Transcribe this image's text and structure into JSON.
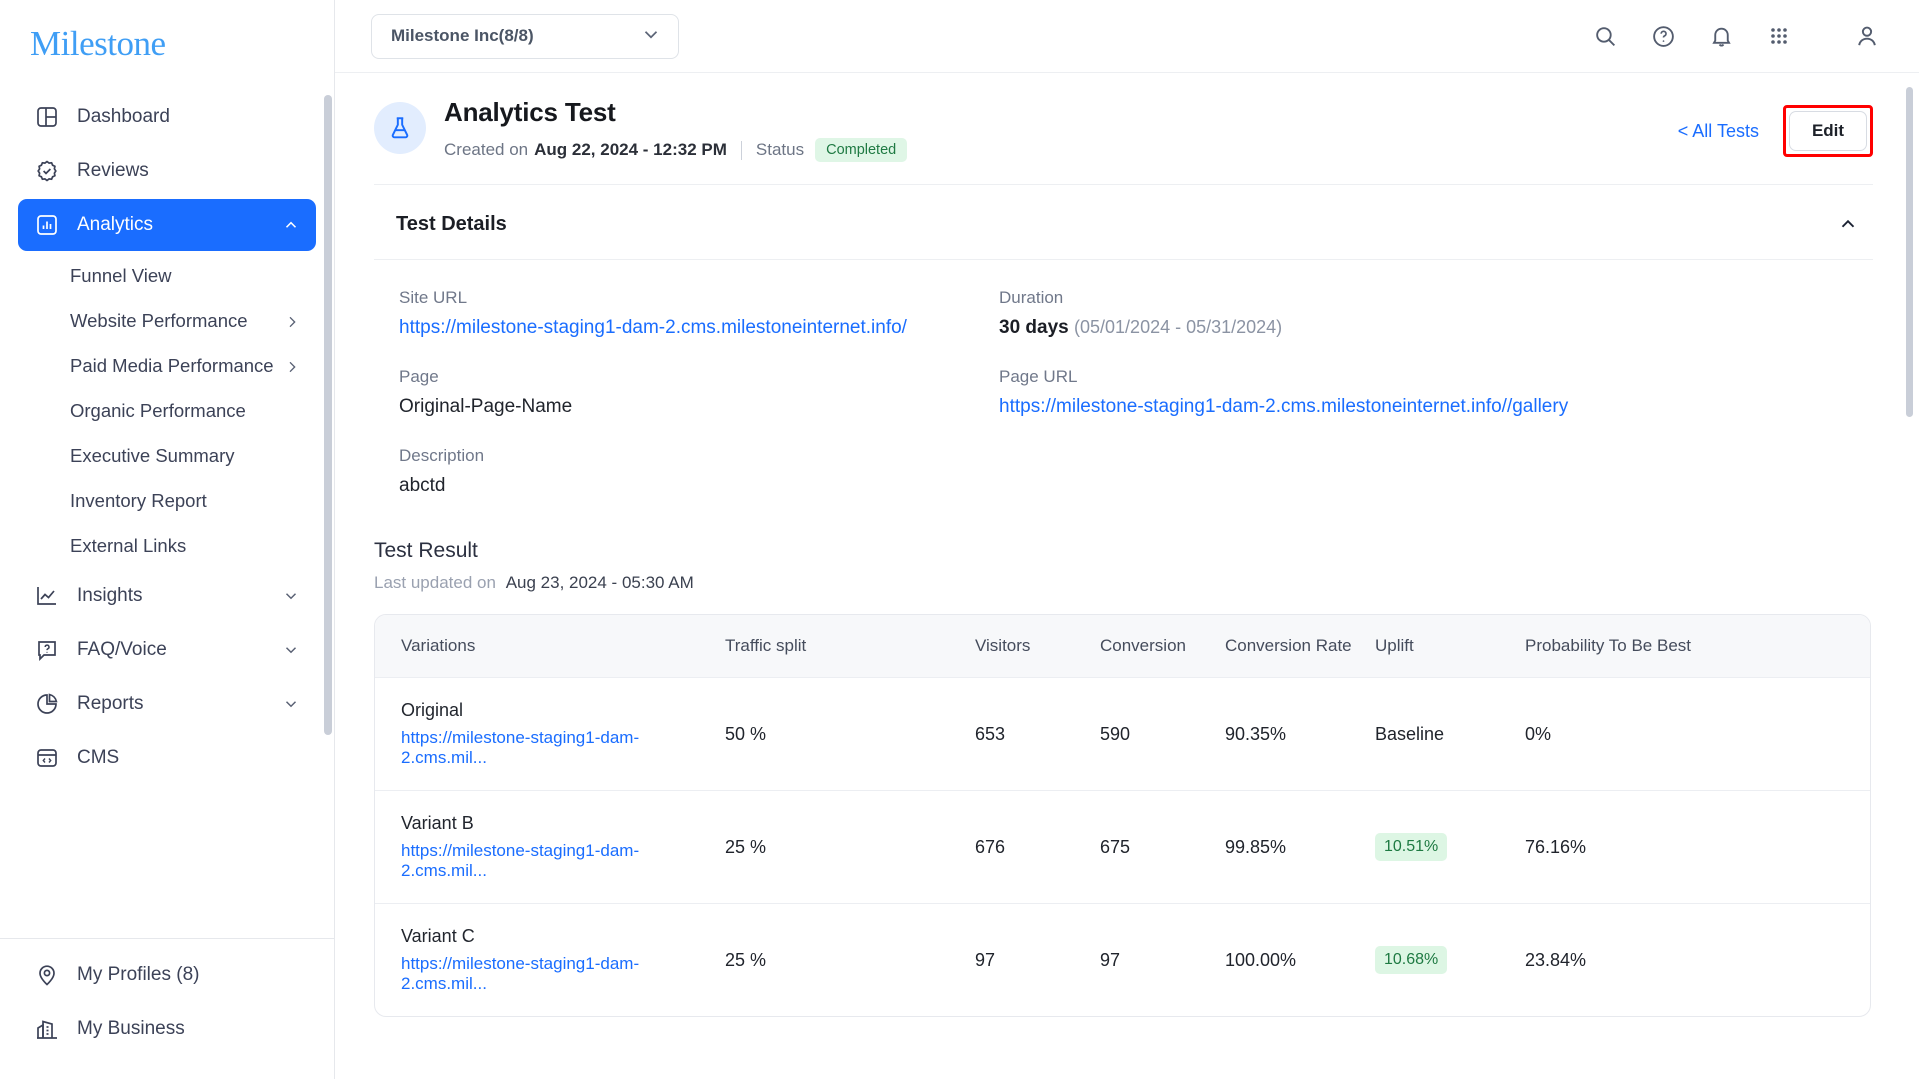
{
  "brand": {
    "logo_text": "Milestone"
  },
  "sidebar": {
    "items": [
      {
        "label": "Dashboard",
        "icon": "dashboard-icon"
      },
      {
        "label": "Reviews",
        "icon": "check-badge-icon"
      },
      {
        "label": "Analytics",
        "icon": "bar-chart-icon",
        "chevron": "chevron-up-icon",
        "active": true
      }
    ],
    "analytics_subitems": [
      {
        "label": "Funnel View"
      },
      {
        "label": "Website Performance",
        "chevron": "chevron-right-icon"
      },
      {
        "label": "Paid Media Performance",
        "chevron": "chevron-right-icon"
      },
      {
        "label": "Organic Performance"
      },
      {
        "label": "Executive Summary"
      },
      {
        "label": "Inventory Report"
      },
      {
        "label": "External Links"
      }
    ],
    "items_after": [
      {
        "label": "Insights",
        "icon": "trend-line-icon",
        "chevron": "chevron-down-icon"
      },
      {
        "label": "FAQ/Voice",
        "icon": "question-bubble-icon",
        "chevron": "chevron-down-icon"
      },
      {
        "label": "Reports",
        "icon": "pie-chart-icon",
        "chevron": "chevron-down-icon"
      },
      {
        "label": "CMS",
        "icon": "code-window-icon"
      }
    ],
    "bottom_items": [
      {
        "label": "My Profiles (8)",
        "icon": "location-pin-icon"
      },
      {
        "label": "My Business",
        "icon": "building-icon"
      }
    ]
  },
  "topbar": {
    "account_selector": {
      "value": "Milestone Inc(8/8)",
      "chevron": "chevron-down-icon"
    },
    "icons": [
      {
        "name": "search-icon"
      },
      {
        "name": "help-circle-icon"
      },
      {
        "name": "bell-icon"
      },
      {
        "name": "apps-grid-icon"
      },
      {
        "name": "user-account-icon"
      }
    ]
  },
  "page": {
    "icon": "flask-icon",
    "title": "Analytics Test",
    "created_prefix": "Created on",
    "created_value": "Aug 22, 2024 - 12:32 PM",
    "status_label": "Status",
    "status_value": "Completed",
    "all_tests_link": "< All Tests",
    "edit_button": "Edit",
    "highlight_color": "#ff0000"
  },
  "test_details": {
    "section_title": "Test Details",
    "collapse_icon": "chevron-up-icon",
    "site_url_label": "Site URL",
    "site_url_value": "https://milestone-staging1-dam-2.cms.milestoneinternet.info/",
    "duration_label": "Duration",
    "duration_value": "30 days",
    "duration_range": "(05/01/2024 - 05/31/2024)",
    "page_label": "Page",
    "page_value": "Original-Page-Name",
    "page_url_label": "Page URL",
    "page_url_value": "https://milestone-staging1-dam-2.cms.milestoneinternet.info//gallery",
    "description_label": "Description",
    "description_value": "abctd"
  },
  "test_result": {
    "title": "Test Result",
    "updated_prefix": "Last updated on",
    "updated_value": "Aug 23, 2024 - 05:30 AM",
    "columns": [
      "Variations",
      "Traffic split",
      "Visitors",
      "Conversion",
      "Conversion Rate",
      "Uplift",
      "Probability To Be Best"
    ],
    "rows": [
      {
        "variation": "Original",
        "url": "https://milestone-staging1-dam-2.cms.mil...",
        "traffic_split": "50 %",
        "visitors": "653",
        "conversion": "590",
        "conversion_rate": "90.35%",
        "uplift": "Baseline",
        "uplift_pill": false,
        "probability": "0%"
      },
      {
        "variation": "Variant B",
        "url": "https://milestone-staging1-dam-2.cms.mil...",
        "traffic_split": "25 %",
        "visitors": "676",
        "conversion": "675",
        "conversion_rate": "99.85%",
        "uplift": "10.51%",
        "uplift_pill": true,
        "probability": "76.16%"
      },
      {
        "variation": "Variant C",
        "url": "https://milestone-staging1-dam-2.cms.mil...",
        "traffic_split": "25 %",
        "visitors": "97",
        "conversion": "97",
        "conversion_rate": "100.00%",
        "uplift": "10.68%",
        "uplift_pill": true,
        "probability": "23.84%"
      }
    ]
  }
}
